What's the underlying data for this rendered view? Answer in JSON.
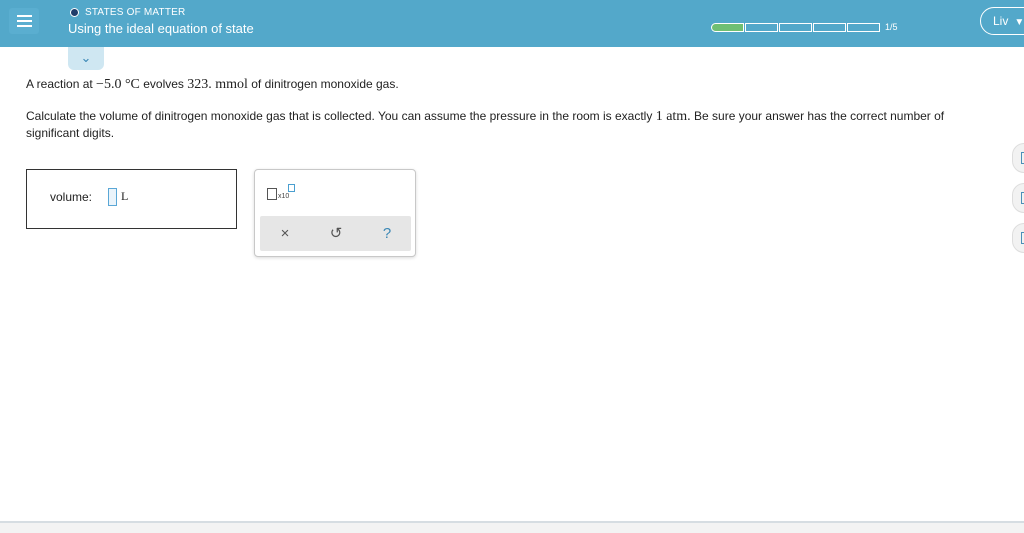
{
  "header": {
    "topic": "STATES OF MATTER",
    "lesson_title": "Using the ideal equation of state",
    "progress": {
      "completed": 1,
      "total": 5,
      "label": "1/5"
    },
    "user_label": "Liv",
    "colors": {
      "bar": "#53a8ca",
      "progress_done": "#6fbf73"
    }
  },
  "question": {
    "line1_prefix": "A reaction at ",
    "temperature": "−5.0 °C",
    "line1_mid": " evolves ",
    "amount": "323. mmol",
    "line1_suffix": " of dinitrogen monoxide gas.",
    "line2_prefix": "Calculate the volume of dinitrogen monoxide gas that is collected. You can assume the pressure in the room is exactly ",
    "pressure": "1 atm.",
    "line2_suffix": " Be sure your answer has the correct number of significant digits."
  },
  "answer": {
    "label": "volume:",
    "unit": "L",
    "value": ""
  },
  "palette": {
    "sci_label": "x10",
    "clear": "×",
    "undo": "↺",
    "help": "?"
  },
  "icons": [
    "menu-icon",
    "chevron-down-icon",
    "close-icon",
    "undo-icon",
    "help-icon"
  ]
}
